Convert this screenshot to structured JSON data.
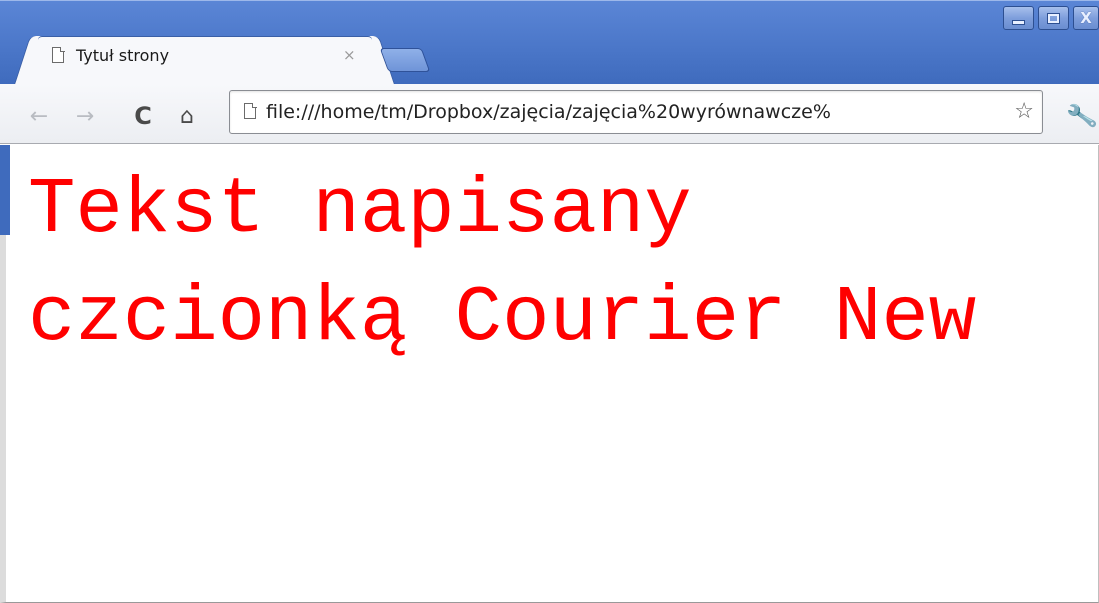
{
  "window": {
    "tab_title": "Tytuł strony",
    "tab_close": "×",
    "controls": {
      "minimize_icon": "minimize-icon",
      "maximize_icon": "maximize-icon",
      "close_icon": "close-icon",
      "close_glyph": "X"
    }
  },
  "toolbar": {
    "back_glyph": "←",
    "forward_glyph": "→",
    "reload_glyph": "C",
    "home_glyph": "⌂",
    "url": "file:///home/tm/Dropbox/zajęcia/zajęcia%20wyrównawcze%",
    "star_glyph": "☆",
    "wrench_glyph": "🔧"
  },
  "page": {
    "line1": "Tekst napisany",
    "line2": "czcionką Courier New",
    "text_color": "#ff0000"
  },
  "colors": {
    "titlebar": "#4a76c8",
    "toolbar": "#eceef2"
  }
}
